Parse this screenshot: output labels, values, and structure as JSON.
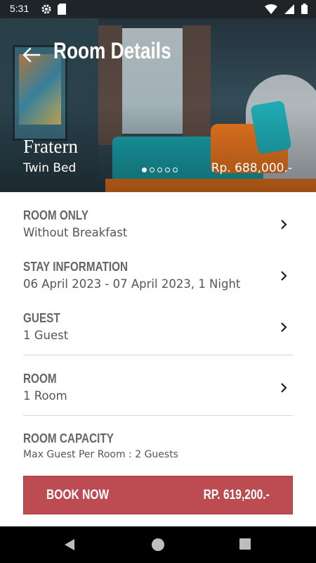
{
  "status_bar": {
    "time": "5:31",
    "icons_left": [
      "gear-icon",
      "sd-card-icon"
    ],
    "icons_right": [
      "wifi-icon",
      "signal-icon",
      "battery-icon"
    ]
  },
  "header": {
    "title": "Room Details",
    "back_icon": "arrow-left-icon"
  },
  "hero": {
    "room_name": "Fratern",
    "bed_type": "Twin Bed",
    "price": "Rp. 688,000.-",
    "carousel": {
      "count": 5,
      "active_index": 0
    }
  },
  "sections": {
    "meal": {
      "label": "ROOM ONLY",
      "value": "Without Breakfast"
    },
    "stay": {
      "label": "STAY INFORMATION",
      "value": "06 April 2023 - 07 April 2023, 1 Night"
    },
    "guest": {
      "label": "GUEST",
      "value": "1 Guest"
    },
    "room": {
      "label": "ROOM",
      "value": "1 Room"
    },
    "capacity": {
      "label": "ROOM CAPACITY",
      "value": "Max Guest Per Room : 2 Guests"
    }
  },
  "booking": {
    "button_label": "BOOK NOW",
    "price": "RP. 619,200.-"
  },
  "colors": {
    "accent": "#bc4b52",
    "status_bar": "#1f2428",
    "label_text": "#666666"
  }
}
